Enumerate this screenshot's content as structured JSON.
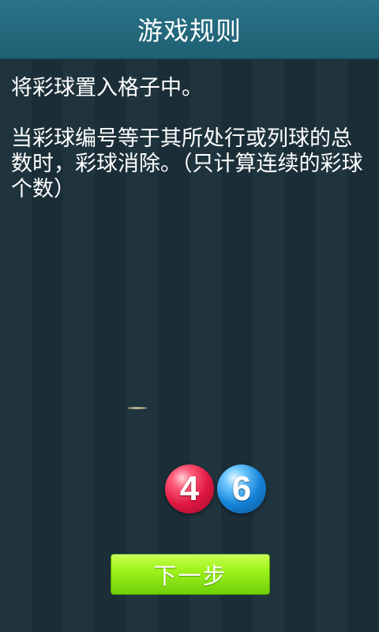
{
  "header": {
    "title": "游戏规则"
  },
  "rules": {
    "line1": "将彩球置入格子中。",
    "line2": "当彩球编号等于其所处行或列球的总数时，彩球消除。（只计算连续的彩球个数）"
  },
  "balls": [
    {
      "number": "4",
      "color": "#e01843"
    },
    {
      "number": "6",
      "color": "#1683d8"
    }
  ],
  "actions": {
    "next_label": "下一步"
  },
  "colors": {
    "title_bar": "#2a7388",
    "background": "#1e323b",
    "button": "#9ff21b"
  }
}
